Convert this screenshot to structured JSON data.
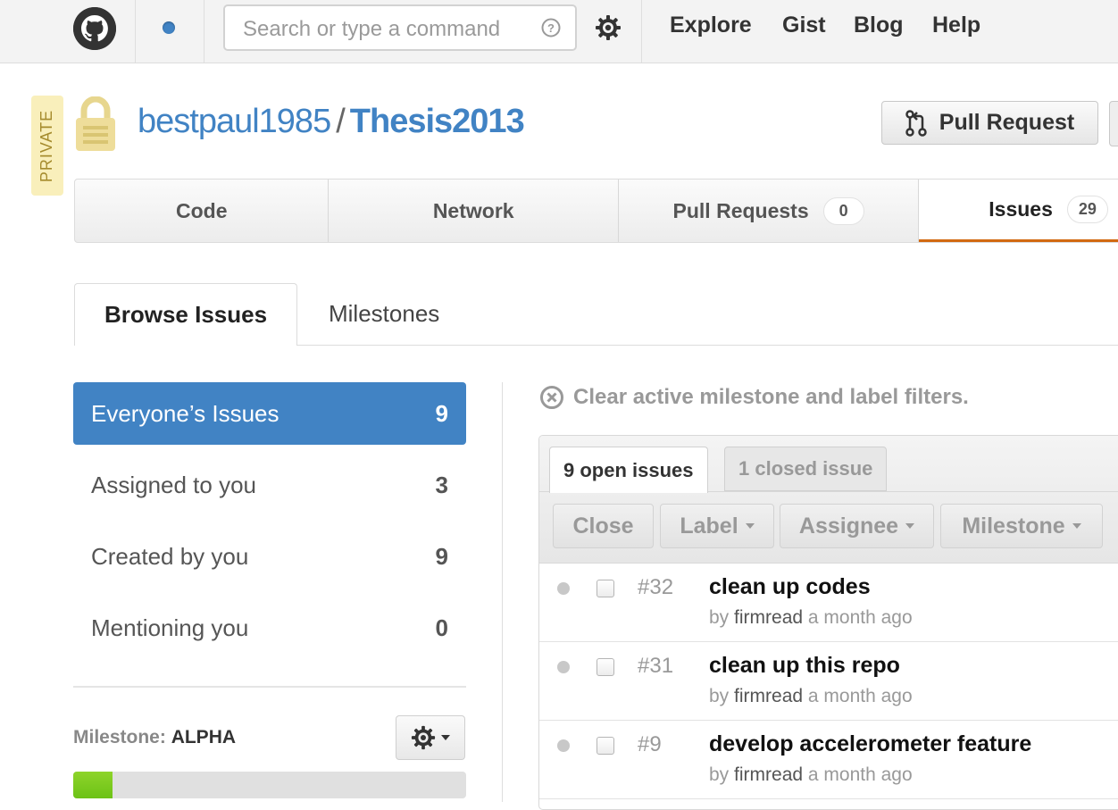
{
  "header": {
    "search_placeholder": "Search or type a command",
    "nav": [
      "Explore",
      "Gist",
      "Blog",
      "Help"
    ]
  },
  "repo": {
    "private_label": "PRIVATE",
    "owner": "bestpaul1985",
    "separator": "/",
    "name": "Thesis2013",
    "pull_request_label": "Pull Request"
  },
  "repo_tabs": {
    "code": "Code",
    "network": "Network",
    "pull_requests": "Pull Requests",
    "pull_requests_count": "0",
    "issues": "Issues",
    "issues_count": "29"
  },
  "subtabs": {
    "browse": "Browse Issues",
    "milestones": "Milestones"
  },
  "filters": [
    {
      "label": "Everyone’s Issues",
      "count": "9"
    },
    {
      "label": "Assigned to you",
      "count": "3"
    },
    {
      "label": "Created by you",
      "count": "9"
    },
    {
      "label": "Mentioning you",
      "count": "0"
    }
  ],
  "milestone": {
    "prefix": "Milestone:",
    "name": "ALPHA",
    "progress": 0.1
  },
  "main": {
    "clear_filters": "Clear active milestone and label filters.",
    "open_tab": "9 open issues",
    "closed_tab": "1 closed issue",
    "actions": {
      "close": "Close",
      "label": "Label",
      "assignee": "Assignee",
      "milestone": "Milestone"
    },
    "issues": [
      {
        "number": "#32",
        "title": "clean up codes",
        "by": "by",
        "author": "firmread",
        "time": "a month ago"
      },
      {
        "number": "#31",
        "title": "clean up this repo",
        "by": "by",
        "author": "firmread",
        "time": "a month ago"
      },
      {
        "number": "#9",
        "title": "develop accelerometer feature",
        "by": "by",
        "author": "firmread",
        "time": "a month ago"
      }
    ]
  },
  "colors": {
    "link": "#4183c4",
    "active_tab_underline": "#d26911",
    "progress": "#6cc216",
    "private_badge": "#f9efbb"
  }
}
